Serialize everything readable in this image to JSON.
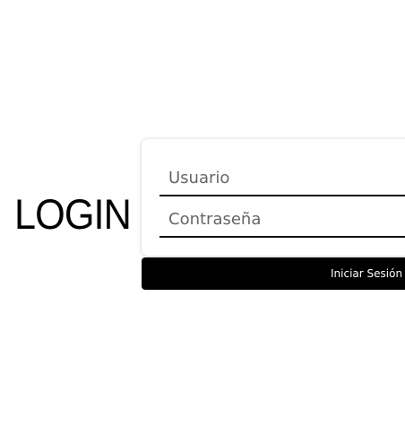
{
  "login": {
    "title": "LOGIN",
    "username_placeholder": "Usuario",
    "username_value": "",
    "password_placeholder": "Contraseña",
    "password_value": "",
    "submit_label": "Iniciar Sesión"
  },
  "colors": {
    "background": "#ffffff",
    "text": "#000000",
    "button_background": "#000000",
    "button_text": "#ffffff",
    "underline": "#111111",
    "placeholder": "#666666"
  }
}
